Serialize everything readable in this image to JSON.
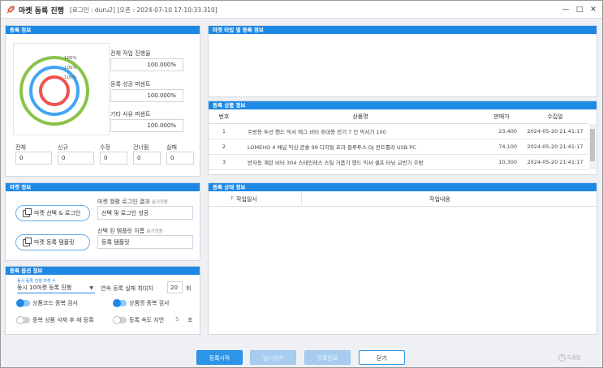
{
  "window": {
    "title": "마켓 등록 진행",
    "subtitle": "[로그인 : duru2] [오픈 : 2024-07-10 17:10:33.310]",
    "min_label": "—",
    "max_label": "□",
    "close_label": "✕"
  },
  "reg_info": {
    "header": "등록 정보",
    "rings": [
      {
        "label": "100%",
        "color": "#8bc34a"
      },
      {
        "label": "100%",
        "color": "#42a5f5"
      },
      {
        "label": "100%",
        "color": "#ef5350"
      }
    ],
    "progress_fraction": 1.0,
    "total_progress_label": "전체 작업 진행율",
    "total_progress_value": "100.000%",
    "success_label": "등록 성공 퍼센트",
    "success_value": "100.000%",
    "other_label": "기타 사유 퍼센트",
    "other_value": "100.000%",
    "counts": [
      {
        "label": "전체",
        "value": "0"
      },
      {
        "label": "신규",
        "value": "0"
      },
      {
        "label": "수정",
        "value": "0"
      },
      {
        "label": "건너뜀",
        "value": "0"
      },
      {
        "label": "실패",
        "value": "0"
      }
    ]
  },
  "market_info": {
    "header": "마켓 정보",
    "select_login_button": "마켓 선택 & 로그인",
    "template_button": "마켓 등록 템플릿",
    "login_result_label": "마켓 월활 로그인 결과",
    "login_result_note": "읽기전용",
    "login_result_value": "선택 및 로그인 성공",
    "template_name_label": "선택 된 템플릿 이름",
    "template_name_note": "읽기전용",
    "template_name_value": "등록 템플릿"
  },
  "options": {
    "header": "등록 옵션 정보",
    "mode_caption": "동시 등록 진행 마켓 수",
    "mode_value": "동시 10마켓 등록 진행",
    "fail_max_label": "연속 등록 실패 최대치",
    "fail_max_value": "20",
    "fail_max_unit": "회",
    "opt_code_check": "상품코드 중복 검사",
    "opt_name_check": "상품명 중복 검사",
    "opt_delete_reregister": "중복 상품 삭제 후 재 등록",
    "opt_delay": "등록 속도 지연",
    "delay_value": "5",
    "delay_unit": "초",
    "toggles": {
      "code_check": true,
      "name_check": true,
      "delete_reregister": false,
      "delay": false
    }
  },
  "market_type": {
    "header": "마켓 타입 별 등록 정보"
  },
  "products": {
    "header": "등록 상품 정보",
    "columns": [
      "번호",
      "상품명",
      "판매가",
      "수집일"
    ],
    "rows": [
      [
        "1",
        "주방용 두선 핸드 믹서 에그 비터 휴대용 전기 7 단 믹서기 100",
        "23,400",
        "2024-05-20 21:41:17"
      ],
      [
        "2",
        "LOMEHO 4 채널 믹싱 콘솔 99 디지털 효과 블루투스 DJ 컨트롤러 USB PC",
        "74,100",
        "2024-05-20 21:41:17"
      ],
      [
        "3",
        "반자동 계란 비터 304 스테인레스 스틸 거품기 핸드 믹서 셀프 터닝 교반기 주방",
        "10,300",
        "2024-05-20 21:41:17"
      ]
    ]
  },
  "status": {
    "header": "등록 상태 정보",
    "columns": [
      "작업일시",
      "작업내용"
    ],
    "sort_icon": "up-arrow-icon"
  },
  "footer": {
    "start": "등록시작",
    "pause": "일시정지",
    "finish": "등록완료",
    "close": "닫기",
    "help": "도움말"
  }
}
